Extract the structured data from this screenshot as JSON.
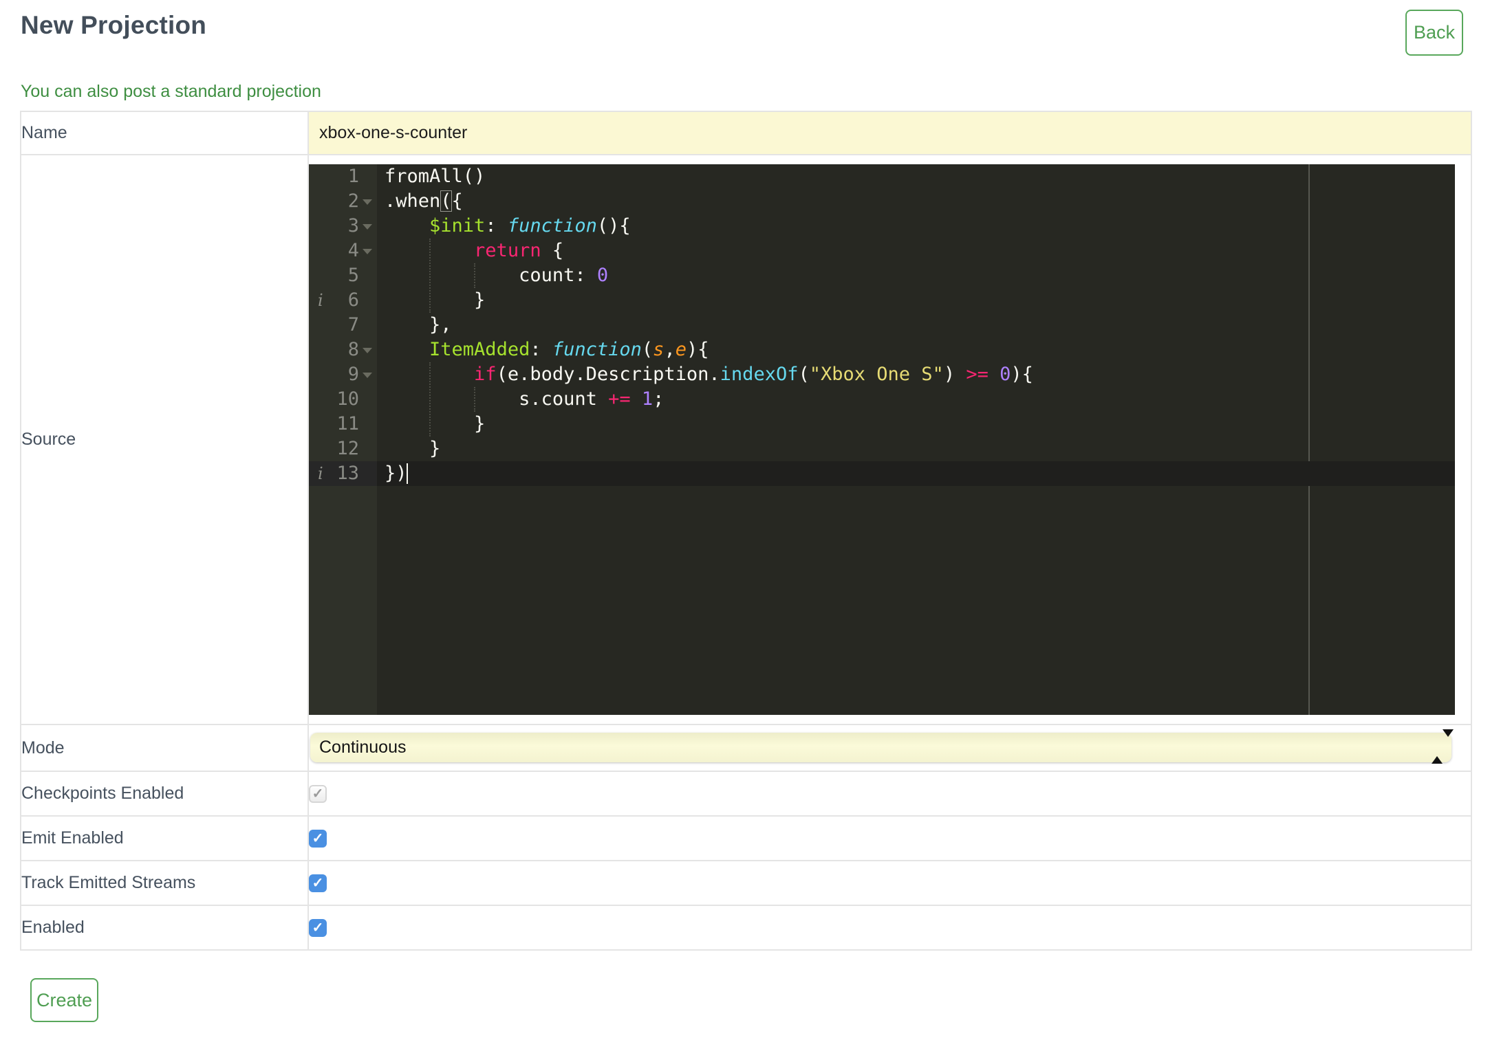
{
  "page": {
    "title": "New Projection",
    "back_label": "Back",
    "standard_link": "You can also post a standard projection",
    "create_label": "Create"
  },
  "form": {
    "name": {
      "label": "Name",
      "value": "xbox-one-s-counter"
    },
    "source": {
      "label": "Source"
    },
    "mode": {
      "label": "Mode",
      "value": "Continuous"
    },
    "checkpoints": {
      "label": "Checkpoints Enabled",
      "checked": true,
      "disabled": true
    },
    "emit": {
      "label": "Emit Enabled",
      "checked": true,
      "disabled": false
    },
    "track": {
      "label": "Track Emitted Streams",
      "checked": true,
      "disabled": false
    },
    "enabled": {
      "label": "Enabled",
      "checked": true,
      "disabled": false
    }
  },
  "editor": {
    "language": "javascript",
    "active_line": 13,
    "colors": {
      "background": "#272822",
      "gutter": "#2f3129",
      "active_line": "#1f1f1d",
      "text": "#f8f8f2",
      "keyword": "#f92672",
      "entity": "#a6e22e",
      "support": "#66d9ef",
      "string": "#e6db74",
      "number": "#ae81ff",
      "params": "#fd971f",
      "line_number": "#8a8b85"
    },
    "lines": [
      {
        "n": 1,
        "tokens": [
          {
            "c": "p",
            "t": "fromAll()"
          }
        ]
      },
      {
        "n": 2,
        "fold": true,
        "tokens": [
          {
            "c": "p",
            "t": ".when"
          },
          {
            "c": "p",
            "t": "(",
            "box": true
          },
          {
            "c": "p",
            "t": "{"
          }
        ]
      },
      {
        "n": 3,
        "fold": true,
        "tokens": [
          {
            "c": "p",
            "t": "    "
          },
          {
            "c": "g",
            "t": "$init"
          },
          {
            "c": "p",
            "t": ": "
          },
          {
            "c": "fni",
            "t": "function"
          },
          {
            "c": "p",
            "t": "(){"
          }
        ]
      },
      {
        "n": 4,
        "fold": true,
        "tokens": [
          {
            "c": "p",
            "t": "        "
          },
          {
            "c": "k",
            "t": "return"
          },
          {
            "c": "p",
            "t": " {"
          }
        ]
      },
      {
        "n": 5,
        "tokens": [
          {
            "c": "p",
            "t": "            count: "
          },
          {
            "c": "n",
            "t": "0"
          }
        ]
      },
      {
        "n": 6,
        "ann": true,
        "tokens": [
          {
            "c": "p",
            "t": "        }"
          }
        ]
      },
      {
        "n": 7,
        "tokens": [
          {
            "c": "p",
            "t": "    },"
          }
        ]
      },
      {
        "n": 8,
        "fold": true,
        "tokens": [
          {
            "c": "p",
            "t": "    "
          },
          {
            "c": "g",
            "t": "ItemAdded"
          },
          {
            "c": "p",
            "t": ": "
          },
          {
            "c": "fni",
            "t": "function"
          },
          {
            "c": "p",
            "t": "("
          },
          {
            "c": "arg",
            "t": "s"
          },
          {
            "c": "p",
            "t": ","
          },
          {
            "c": "arg",
            "t": "e"
          },
          {
            "c": "p",
            "t": "){"
          }
        ]
      },
      {
        "n": 9,
        "fold": true,
        "tokens": [
          {
            "c": "p",
            "t": "        "
          },
          {
            "c": "k",
            "t": "if"
          },
          {
            "c": "p",
            "t": "(e.body.Description."
          },
          {
            "c": "fn",
            "t": "indexOf"
          },
          {
            "c": "p",
            "t": "("
          },
          {
            "c": "s",
            "t": "\"Xbox One S\""
          },
          {
            "c": "p",
            "t": ") "
          },
          {
            "c": "k",
            "t": ">="
          },
          {
            "c": "p",
            "t": " "
          },
          {
            "c": "n",
            "t": "0"
          },
          {
            "c": "p",
            "t": "){"
          }
        ]
      },
      {
        "n": 10,
        "tokens": [
          {
            "c": "p",
            "t": "            s.count "
          },
          {
            "c": "k",
            "t": "+="
          },
          {
            "c": "p",
            "t": " "
          },
          {
            "c": "n",
            "t": "1"
          },
          {
            "c": "p",
            "t": ";"
          }
        ]
      },
      {
        "n": 11,
        "tokens": [
          {
            "c": "p",
            "t": "        }"
          }
        ]
      },
      {
        "n": 12,
        "tokens": [
          {
            "c": "p",
            "t": "    }"
          }
        ]
      },
      {
        "n": 13,
        "ann": true,
        "active": true,
        "tokens": [
          {
            "c": "p",
            "t": "})"
          }
        ]
      }
    ]
  },
  "ui_colors": {
    "accent_green": "#3e8e41",
    "button_green": "#58a75b",
    "input_yellow": "#fbf8d3",
    "checkbox_blue": "#4a90e2",
    "label_slate": "#46515e"
  }
}
